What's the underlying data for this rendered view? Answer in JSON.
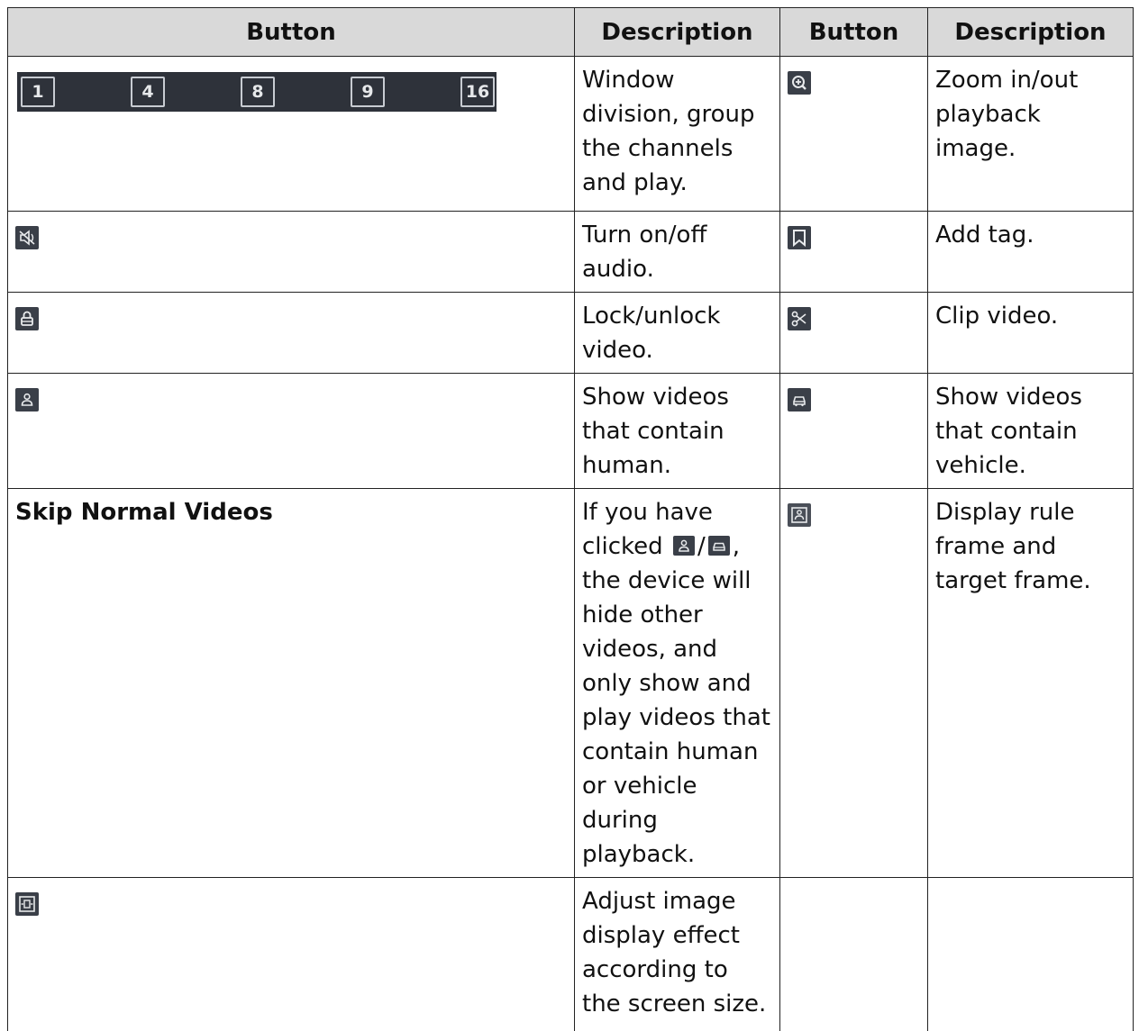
{
  "header": {
    "col1": "Button",
    "col2": "Description",
    "col3": "Button",
    "col4": "Description"
  },
  "division_buttons": [
    "1",
    "4",
    "8",
    "9",
    "16"
  ],
  "rows": [
    {
      "left_icon": "window-division-buttons",
      "left_desc": "Window division, group the channels and play.",
      "right_icon": "zoom-in-icon",
      "right_desc": "Zoom in/out playback image."
    },
    {
      "left_icon": "audio-mute-icon",
      "left_desc": "Turn on/off audio.",
      "right_icon": "bookmark-tag-icon",
      "right_desc": "Add tag."
    },
    {
      "left_icon": "lock-icon",
      "left_desc": "Lock/unlock video.",
      "right_icon": "scissors-clip-icon",
      "right_desc": "Clip video."
    },
    {
      "left_icon": "human-filter-icon",
      "left_desc": "Show videos that contain human.",
      "right_icon": "vehicle-filter-icon",
      "right_desc": "Show videos that contain vehicle."
    },
    {
      "left_label": "Skip Normal Videos",
      "left_desc_pre": "If you have clicked",
      "left_desc_sep": "/",
      "left_desc_post": ", the device will hide other videos, and only show and play videos that contain human or vehicle during playback.",
      "right_icon": "rule-frame-icon",
      "right_desc": "Display rule frame and target frame."
    },
    {
      "left_icon": "fit-screen-icon",
      "left_desc": "Adjust image display effect according to the screen size.",
      "right_desc": ""
    }
  ]
}
